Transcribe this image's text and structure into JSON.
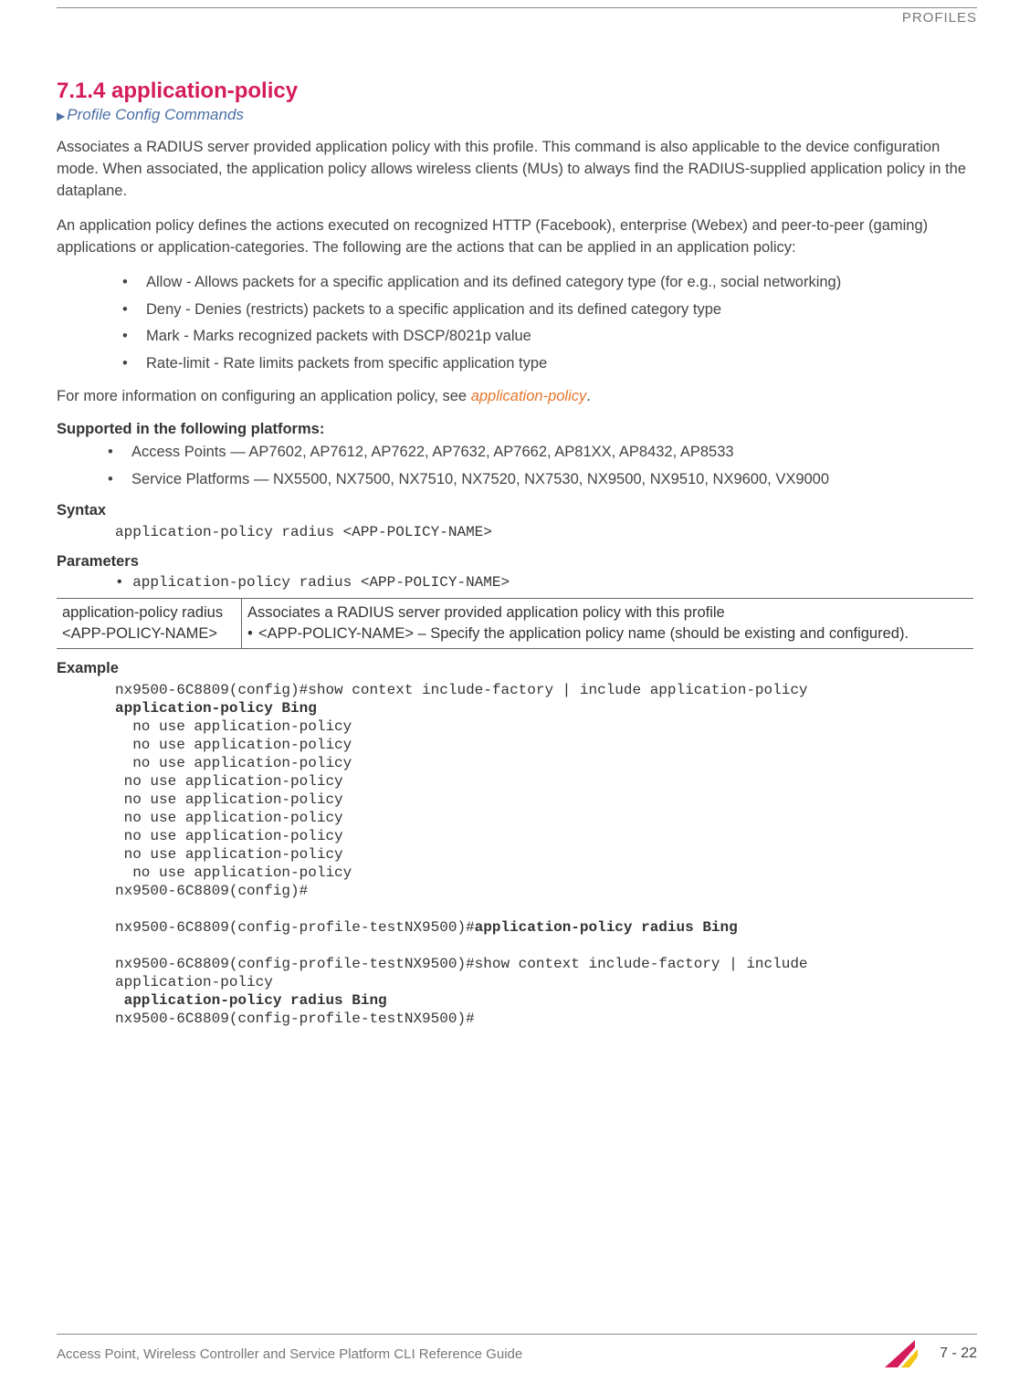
{
  "running_header": "PROFILES",
  "section_number": "7.1.4 application-policy",
  "breadcrumb": "Profile Config Commands",
  "para1": "Associates a RADIUS server provided application policy with this profile. This command is also applicable to the device configuration mode. When associated, the application policy allows wireless clients (MUs) to always find the RADIUS-supplied application policy in the dataplane.",
  "para2": "An application policy defines the actions executed on recognized HTTP (Facebook), enterprise (Webex) and peer-to-peer (gaming) applications or application-categories. The following are the actions that can be applied in an application policy:",
  "actions": [
    "Allow - Allows packets for a specific application and its defined category type (for e.g., social networking)",
    "Deny - Denies (restricts) packets to a specific application and its defined category type",
    "Mark - Marks recognized packets with DSCP/8021p value",
    "Rate-limit - Rate limits packets from specific application type"
  ],
  "para3_pre": "For more information on configuring an application policy, see ",
  "para3_link": "application-policy",
  "para3_post": ".",
  "supported_heading": "Supported in the following platforms:",
  "supported": [
    "Access Points — AP7602, AP7612, AP7622, AP7632, AP7662, AP81XX, AP8432, AP8533",
    "Service Platforms — NX5500, NX7500, NX7510, NX7520, NX7530, NX9500, NX9510, NX9600, VX9000"
  ],
  "syntax_heading": "Syntax",
  "syntax_line": "application-policy radius <APP-POLICY-NAME>",
  "parameters_heading": "Parameters",
  "parameters_bullet": "• application-policy radius <APP-POLICY-NAME>",
  "param_table": {
    "left": "application-policy radius <APP-POLICY-NAME>",
    "right_line1": "Associates a RADIUS server provided application policy with this profile",
    "right_sub": "<APP-POLICY-NAME> – Specify the application policy name (should be existing and configured)."
  },
  "example_heading": "Example",
  "example": {
    "l1": "nx9500-6C8809(config)#show context include-factory | include application-policy",
    "l2_bold": "application-policy Bing",
    "l3": "  no use application-policy",
    "l4": "  no use application-policy",
    "l5": "  no use application-policy",
    "l6": " no use application-policy",
    "l7": " no use application-policy",
    "l8": " no use application-policy",
    "l9": " no use application-policy",
    "l10": " no use application-policy",
    "l11": "  no use application-policy",
    "l12": "nx9500-6C8809(config)#",
    "blank1": "",
    "l13a": "nx9500-6C8809(config-profile-testNX9500)#",
    "l13b_bold": "application-policy radius Bing",
    "blank2": "",
    "l14": "nx9500-6C8809(config-profile-testNX9500)#show context include-factory | include",
    "l15": "application-policy",
    "l16_bold": " application-policy radius Bing",
    "l17": "nx9500-6C8809(config-profile-testNX9500)#"
  },
  "footer_left": "Access Point, Wireless Controller and Service Platform CLI Reference Guide",
  "footer_page": "7 - 22"
}
